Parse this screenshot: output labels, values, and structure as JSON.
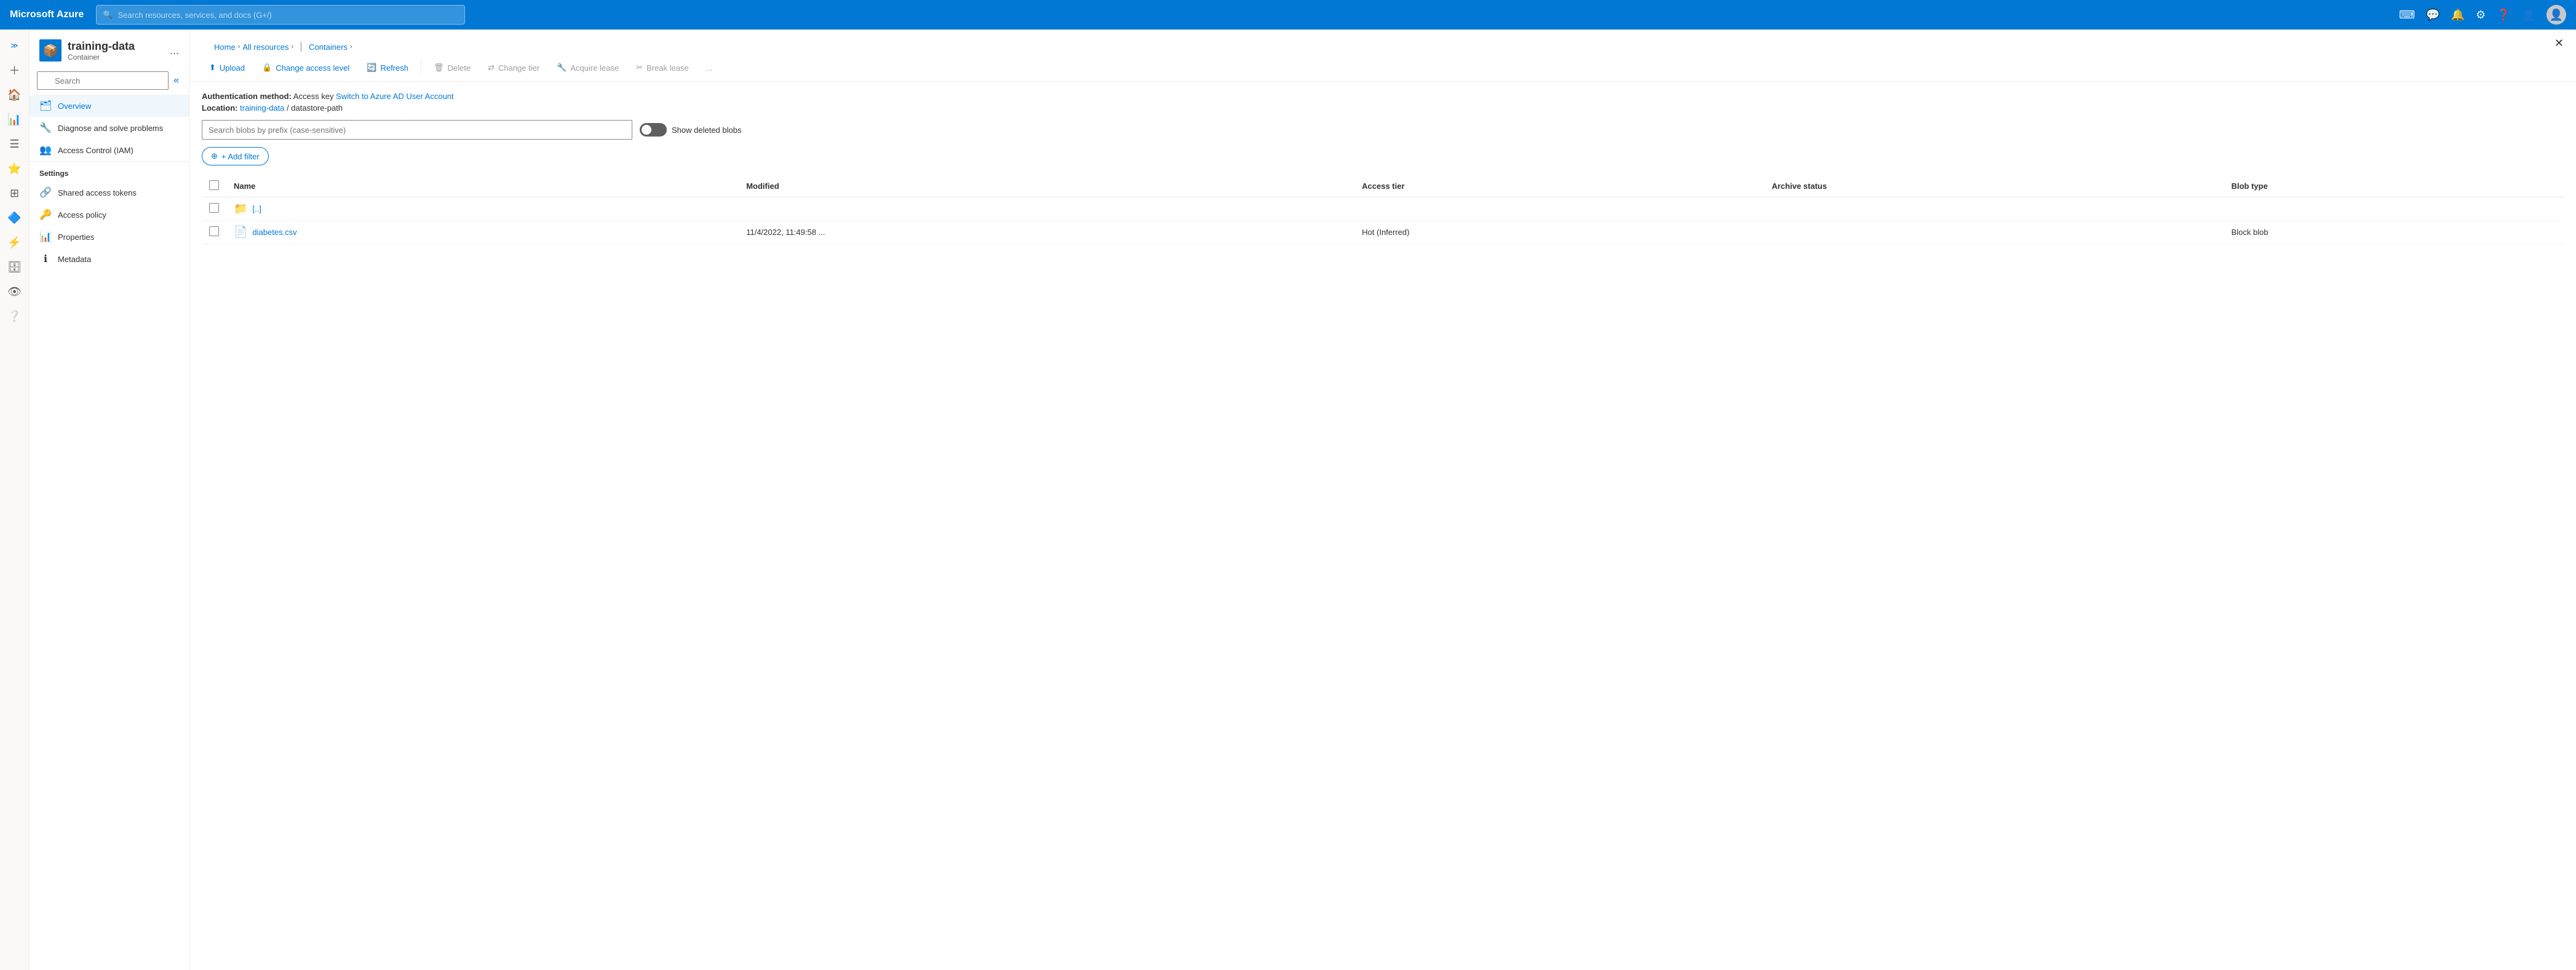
{
  "topnav": {
    "brand": "Microsoft Azure",
    "search_placeholder": "Search resources, services, and docs (G+/)"
  },
  "breadcrumb": {
    "home": "Home",
    "all_resources": "All resources",
    "containers": "Containers"
  },
  "resource": {
    "title": "training-data",
    "subtitle": "Container",
    "more_label": "..."
  },
  "nav_search": {
    "placeholder": "Search"
  },
  "nav_items": [
    {
      "id": "overview",
      "label": "Overview",
      "icon": "🗂",
      "active": true
    },
    {
      "id": "diagnose",
      "label": "Diagnose and solve problems",
      "icon": "🔧",
      "active": false
    },
    {
      "id": "iam",
      "label": "Access Control (IAM)",
      "icon": "👥",
      "active": false
    }
  ],
  "settings_section": "Settings",
  "settings_items": [
    {
      "id": "shared-access-tokens",
      "label": "Shared access tokens",
      "icon": "🔗",
      "active": false
    },
    {
      "id": "access-policy",
      "label": "Access policy",
      "icon": "🔑",
      "active": false
    },
    {
      "id": "properties",
      "label": "Properties",
      "icon": "📊",
      "active": false
    },
    {
      "id": "metadata",
      "label": "Metadata",
      "icon": "ℹ",
      "active": false
    }
  ],
  "toolbar": {
    "upload": "Upload",
    "change_access_level": "Change access level",
    "refresh": "Refresh",
    "delete": "Delete",
    "change_tier": "Change tier",
    "acquire_lease": "Acquire lease",
    "break_lease": "Break lease",
    "more": "..."
  },
  "auth": {
    "label": "Authentication method:",
    "value": "Access key",
    "switch_link": "Switch to Azure AD User Account"
  },
  "location": {
    "label": "Location:",
    "storage": "training-data",
    "path": "datastore-path"
  },
  "blob_search": {
    "placeholder": "Search blobs by prefix (case-sensitive)"
  },
  "show_deleted": "Show deleted blobs",
  "add_filter": "+ Add filter",
  "table": {
    "headers": [
      "Name",
      "Modified",
      "Access tier",
      "Archive status",
      "Blob type"
    ],
    "rows": [
      {
        "checkbox": false,
        "icon": "folder",
        "name": "[..]",
        "modified": "",
        "access_tier": "",
        "archive_status": "",
        "blob_type": ""
      },
      {
        "checkbox": false,
        "icon": "file",
        "name": "diabetes.csv",
        "modified": "11/4/2022, 11:49:58 ...",
        "access_tier": "Hot (Inferred)",
        "archive_status": "",
        "blob_type": "Block blob"
      }
    ]
  }
}
